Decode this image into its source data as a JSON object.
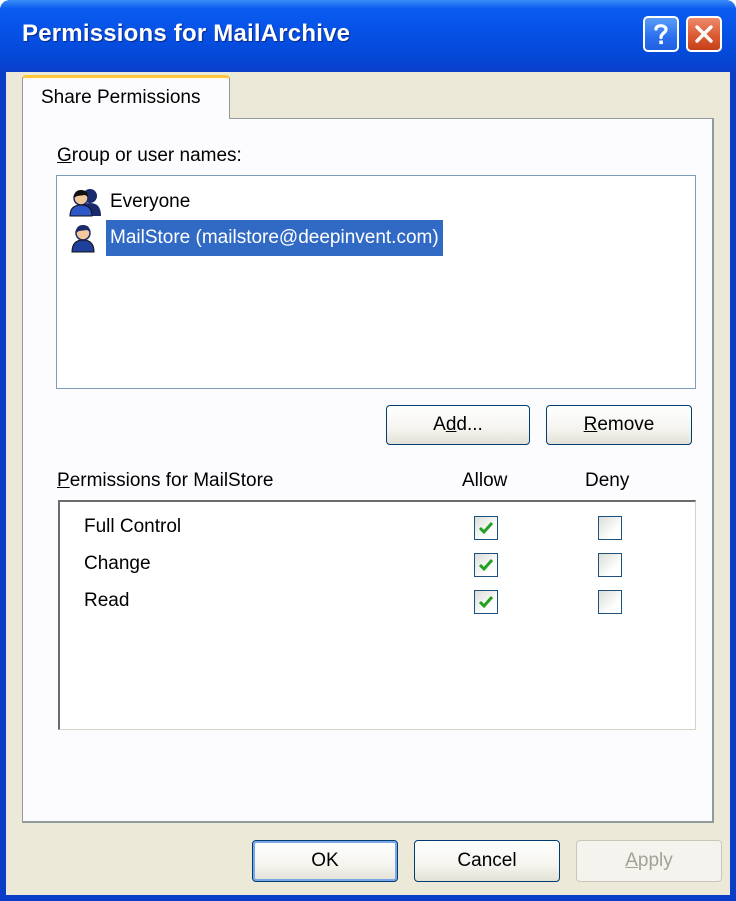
{
  "window": {
    "title": "Permissions for MailArchive"
  },
  "tabs": [
    {
      "label": "Share Permissions",
      "active": true
    }
  ],
  "groups": {
    "label_prefix_underlined": "G",
    "label_rest": "roup or user names:",
    "items": [
      {
        "name": "Everyone",
        "icon": "user-group-icon",
        "selected": false
      },
      {
        "name": "MailStore (mailstore@deepinvent.com)",
        "icon": "user-icon",
        "selected": true
      }
    ]
  },
  "buttons": {
    "add": {
      "pre": "A",
      "underlined": "d",
      "post": "d..."
    },
    "remove": {
      "pre": "",
      "underlined": "R",
      "post": "emove"
    },
    "ok": "OK",
    "cancel": "Cancel",
    "apply": {
      "pre": "",
      "underlined": "A",
      "post": "pply",
      "disabled": true
    }
  },
  "permissions": {
    "label_underlined": "P",
    "label_rest": "ermissions for MailStore",
    "allow_header": "Allow",
    "deny_header": "Deny",
    "rows": [
      {
        "name": "Full Control",
        "allow": true,
        "deny": false
      },
      {
        "name": "Change",
        "allow": true,
        "deny": false
      },
      {
        "name": "Read",
        "allow": true,
        "deny": false
      }
    ]
  },
  "colors": {
    "title_bar": "#0a3ec9",
    "selection": "#316ac5",
    "tab_highlight": "#ffc83c",
    "check_mark": "#21a121"
  }
}
